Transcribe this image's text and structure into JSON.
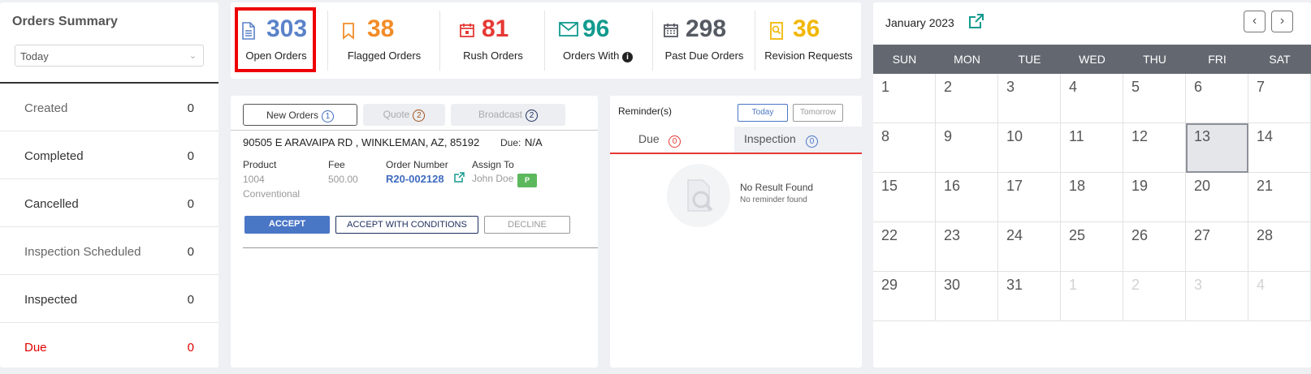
{
  "summary": {
    "title": "Orders Summary",
    "period": "Today",
    "rows": [
      {
        "label": "Created",
        "value": "0"
      },
      {
        "label": "Completed",
        "value": "0"
      },
      {
        "label": "Cancelled",
        "value": "0"
      },
      {
        "label": "Inspection Scheduled",
        "value": "0"
      },
      {
        "label": "Inspected",
        "value": "0"
      },
      {
        "label": "Due",
        "value": "0"
      }
    ]
  },
  "stats": [
    {
      "value": "303",
      "label": "Open Orders",
      "color": "#5b82c9",
      "icon": "document-icon"
    },
    {
      "value": "38",
      "label": "Flagged Orders",
      "color": "#f28c28",
      "icon": "bookmark-icon"
    },
    {
      "value": "81",
      "label": "Rush Orders",
      "color": "#e53935",
      "icon": "calendar-alert-icon"
    },
    {
      "value": "96",
      "label": "Orders With",
      "color": "#139a8e",
      "icon": "envelope-icon"
    },
    {
      "value": "298",
      "label": "Past Due Orders",
      "color": "#555a63",
      "icon": "calendar-icon"
    },
    {
      "value": "36",
      "label": "Revision Requests",
      "color": "#f2b705",
      "icon": "search-document-icon"
    }
  ],
  "orders": {
    "tabs": [
      {
        "label": "New Orders",
        "count": "1"
      },
      {
        "label": "Quote",
        "count": "2"
      },
      {
        "label": "Broadcast",
        "count": "2"
      }
    ],
    "address": "90505 E ARAVAIPA RD , WINKLEMAN, AZ, 85192",
    "due_label": "Due:",
    "due_value": "N/A",
    "product_label": "Product",
    "product_value": "1004",
    "product_value2": "Conventional",
    "fee_label": "Fee",
    "fee_value": "500.00",
    "order_number_label": "Order Number",
    "order_number_value": "R20-002128",
    "assign_label": "Assign To",
    "assign_value": "John Doe",
    "assign_badge": "P",
    "accept": "ACCEPT",
    "accept_conditions": "ACCEPT WITH CONDITIONS",
    "decline": "DECLINE"
  },
  "reminders": {
    "title": "Reminder(s)",
    "today": "Today",
    "tomorrow": "Tomorrow",
    "due_tab": "Due",
    "due_count": "0",
    "inspection_tab": "Inspection",
    "inspection_count": "0",
    "empty_title": "No Result Found",
    "empty_sub": "No reminder found"
  },
  "calendar": {
    "month": "January 2023",
    "days": [
      "SUN",
      "MON",
      "TUE",
      "WED",
      "THU",
      "FRI",
      "SAT"
    ],
    "weeks": [
      [
        "1",
        "2",
        "3",
        "4",
        "5",
        "6",
        "7"
      ],
      [
        "8",
        "9",
        "10",
        "11",
        "12",
        "13",
        "14"
      ],
      [
        "15",
        "16",
        "17",
        "18",
        "19",
        "20",
        "21"
      ],
      [
        "22",
        "23",
        "24",
        "25",
        "26",
        "27",
        "28"
      ],
      [
        "29",
        "30",
        "31",
        "1",
        "2",
        "3",
        "4"
      ]
    ],
    "today": "13"
  }
}
